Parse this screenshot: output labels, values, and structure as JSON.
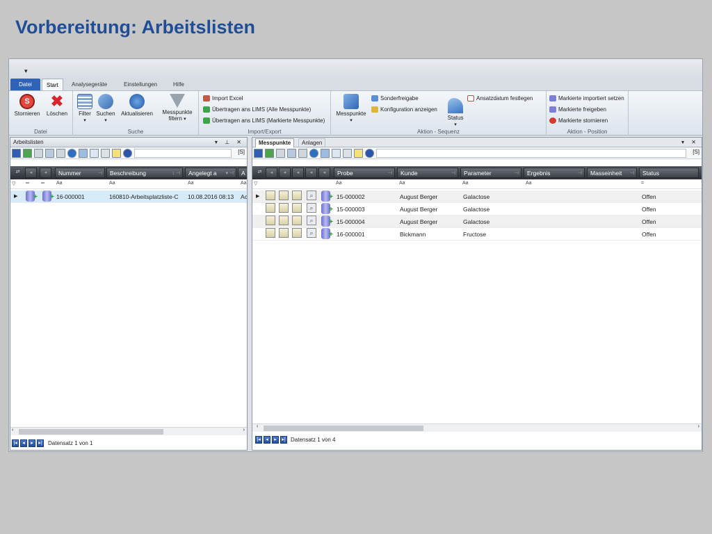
{
  "slide": {
    "title": "Vorbereitung: Arbeitslisten"
  },
  "tabs": [
    "Datei",
    "Start",
    "Analysegeräte",
    "Einstellungen",
    "Hilfe"
  ],
  "ribbon": {
    "groups": {
      "datei": "Datei",
      "suche": "Suche",
      "import": "Import/Export",
      "sequenz": "Aktion - Sequenz",
      "position": "Aktion - Position"
    },
    "buttons": {
      "stornieren": "Stornieren",
      "loeschen": "Löschen",
      "filter": "Filter",
      "suchen": "Suchen",
      "aktualisieren": "Aktualisieren",
      "mp_filtern_1": "Messpunkte",
      "mp_filtern_2": "filtern",
      "messpunkte": "Messpunkte",
      "status": "Status",
      "import_excel": "Import Excel",
      "uebertragen_alle": "Übertragen ans LIMS (Alle Messpunkte)",
      "uebertragen_mark": "Übertragen ans LIMS (Markierte Messpunkte)",
      "sonderfreigabe": "Sonderfreigabe",
      "konfig": "Konfiguration anzeigen",
      "ansatzdatum": "Ansatzdatum festlegen",
      "mark_importiert": "Markierte importiert setzen",
      "mark_freigeben": "Markierte freigeben",
      "mark_stornieren": "Markierte stornieren"
    }
  },
  "left": {
    "title": "Arbeitslisten",
    "search_tag": "[S]",
    "columns": [
      "Nummer",
      "Beschreibung",
      "Angelegt a",
      "A"
    ],
    "filter_hints": [
      "Aa",
      "Aa",
      "Aa",
      "Aa"
    ],
    "rows": [
      {
        "nummer": "16-000001",
        "beschreibung": "160810-Arbeitsplatzliste-C",
        "angelegt": "10.08.2016 08:13",
        "a": "Ac"
      }
    ],
    "nav": "Datensatz 1 von 1"
  },
  "right": {
    "tabs": [
      "Messpunkte",
      "Anlagen"
    ],
    "search_tag": "[S]",
    "columns": [
      "Probe",
      "Kunde",
      "Parameter",
      "Ergebnis",
      "Masseinheit",
      "Status"
    ],
    "filter_hints": [
      "Aa",
      "Aa",
      "Aa",
      "Aa",
      "="
    ],
    "rows": [
      {
        "probe": "15-000002",
        "kunde": "August Berger",
        "parameter": "Galactose",
        "status": "Offen"
      },
      {
        "probe": "15-000003",
        "kunde": "August Berger",
        "parameter": "Galactose",
        "status": "Offen"
      },
      {
        "probe": "15-000004",
        "kunde": "August Berger",
        "parameter": "Galactose",
        "status": "Offen"
      },
      {
        "probe": "16-000001",
        "kunde": "Bickmann",
        "parameter": "Fructose",
        "status": "Offen"
      }
    ],
    "nav": "Datensatz 1 von 4"
  }
}
